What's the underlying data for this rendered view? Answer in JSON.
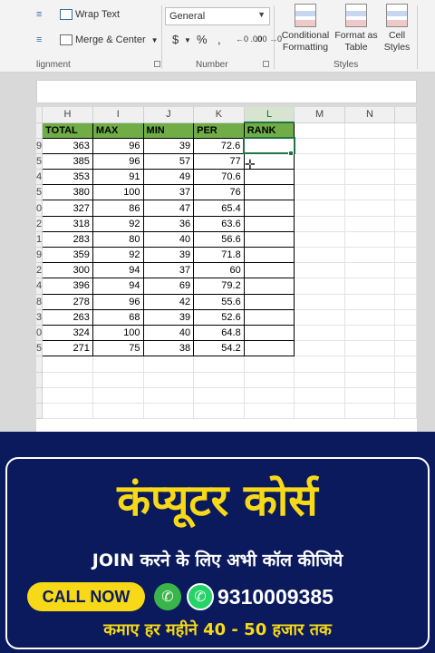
{
  "ribbon": {
    "alignment": {
      "wrap_text": "Wrap Text",
      "merge_center": "Merge & Center",
      "label": "lignment"
    },
    "number": {
      "format": "General",
      "currency": "$",
      "percent": "%",
      "comma": ",",
      "inc_decimal": "←0 .00",
      "dec_decimal": ".00 →0",
      "label": "Number"
    },
    "styles": {
      "conditional": "Conditional Formatting",
      "format_table": "Format as Table",
      "cell_styles": "Cell Styles",
      "label": "Styles"
    }
  },
  "sheet": {
    "columns": [
      "H",
      "I",
      "J",
      "K",
      "L",
      "M",
      "N"
    ],
    "selected_column": "L",
    "headers": [
      "TOTAL",
      "MAX",
      "MIN",
      "PER",
      "RANK"
    ],
    "row_stubs": [
      "9",
      "5",
      "4",
      "5",
      "0",
      "2",
      "1",
      "9",
      "2",
      "4",
      "8",
      "3",
      "0",
      "5"
    ],
    "rows": [
      [
        "363",
        "96",
        "39",
        "72.6"
      ],
      [
        "385",
        "96",
        "57",
        "77"
      ],
      [
        "353",
        "91",
        "49",
        "70.6"
      ],
      [
        "380",
        "100",
        "37",
        "76"
      ],
      [
        "327",
        "86",
        "47",
        "65.4"
      ],
      [
        "318",
        "92",
        "36",
        "63.6"
      ],
      [
        "283",
        "80",
        "40",
        "56.6"
      ],
      [
        "359",
        "92",
        "39",
        "71.8"
      ],
      [
        "300",
        "94",
        "37",
        "60"
      ],
      [
        "396",
        "94",
        "69",
        "79.2"
      ],
      [
        "278",
        "96",
        "42",
        "55.6"
      ],
      [
        "263",
        "68",
        "39",
        "52.6"
      ],
      [
        "324",
        "100",
        "40",
        "64.8"
      ],
      [
        "271",
        "75",
        "38",
        "54.2"
      ]
    ]
  },
  "banner": {
    "title": "कंप्यूटर कोर्स",
    "subtitle": "JOIN करने के लिए अभी कॉल कीजिये",
    "call_now": "CALL NOW",
    "phone": "9310009385",
    "footer": "कमाए हर महीने 40 - 50 हजार तक",
    "icons": [
      "phone-icon",
      "whatsapp-icon"
    ]
  },
  "colors": {
    "header_green": "#70ad47",
    "banner_bg": "#0a1a5c",
    "banner_yellow": "#f7d917"
  }
}
